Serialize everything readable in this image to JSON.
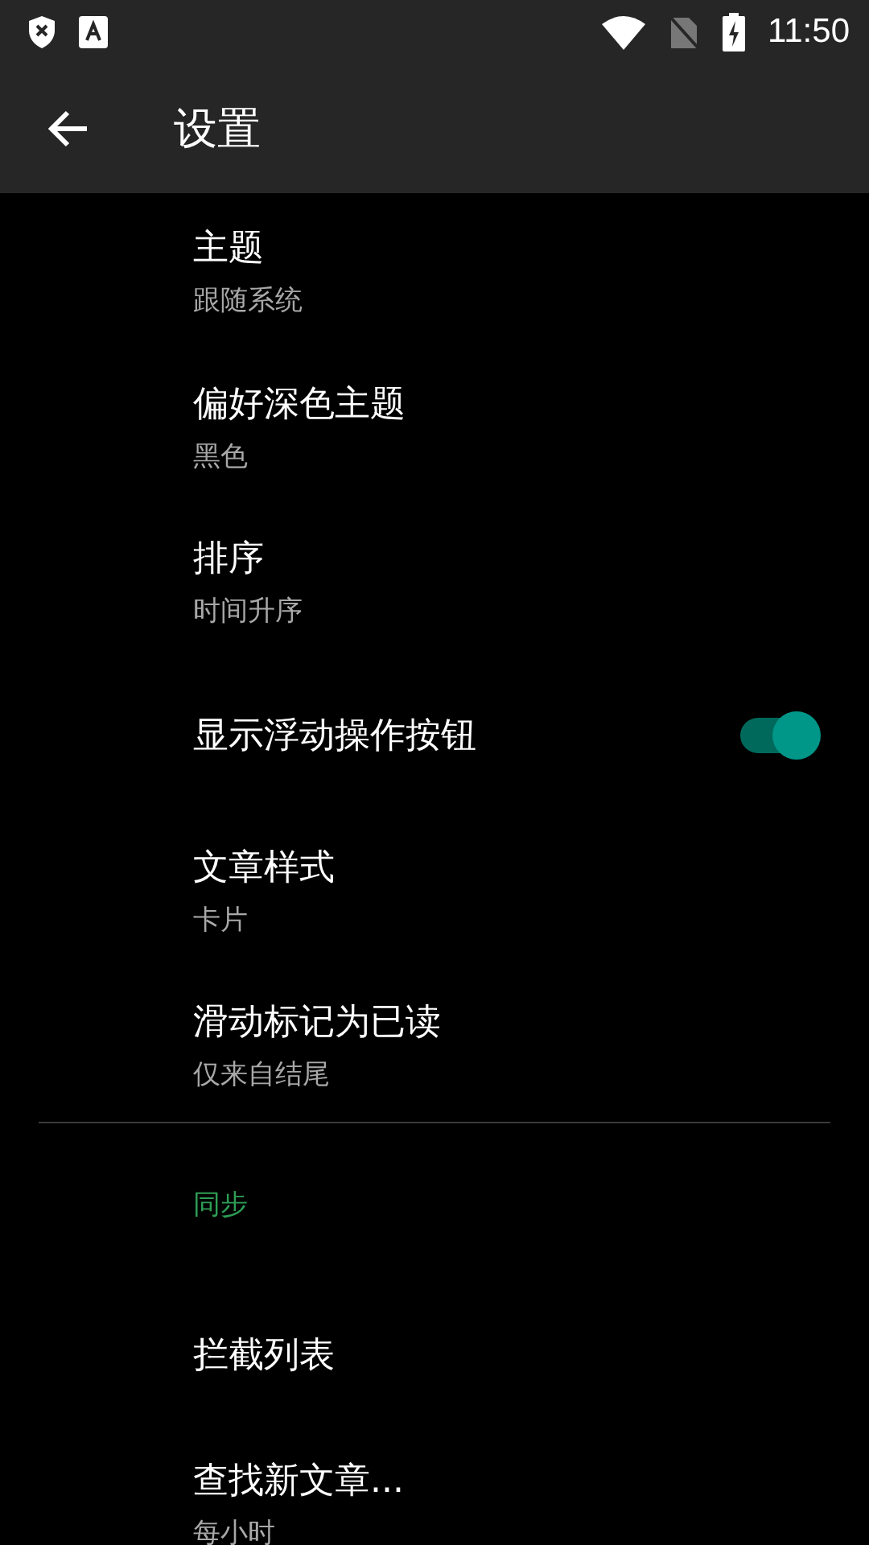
{
  "status_bar": {
    "time": "11:50"
  },
  "toolbar": {
    "title": "设置"
  },
  "settings": [
    {
      "kind": "choice",
      "title": "主题",
      "summary": "跟随系统"
    },
    {
      "kind": "choice",
      "title": "偏好深色主题",
      "summary": "黑色"
    },
    {
      "kind": "choice",
      "title": "排序",
      "summary": "时间升序"
    },
    {
      "kind": "switch",
      "title": "显示浮动操作按钮",
      "on": true
    },
    {
      "kind": "choice",
      "title": "文章样式",
      "summary": "卡片"
    },
    {
      "kind": "choice",
      "title": "滑动标记为已读",
      "summary": "仅来自结尾"
    },
    {
      "kind": "divider"
    },
    {
      "kind": "category",
      "title": "同步"
    },
    {
      "kind": "action",
      "title": "拦截列表"
    },
    {
      "kind": "choice",
      "title": "查找新文章...",
      "summary": "每小时"
    }
  ]
}
